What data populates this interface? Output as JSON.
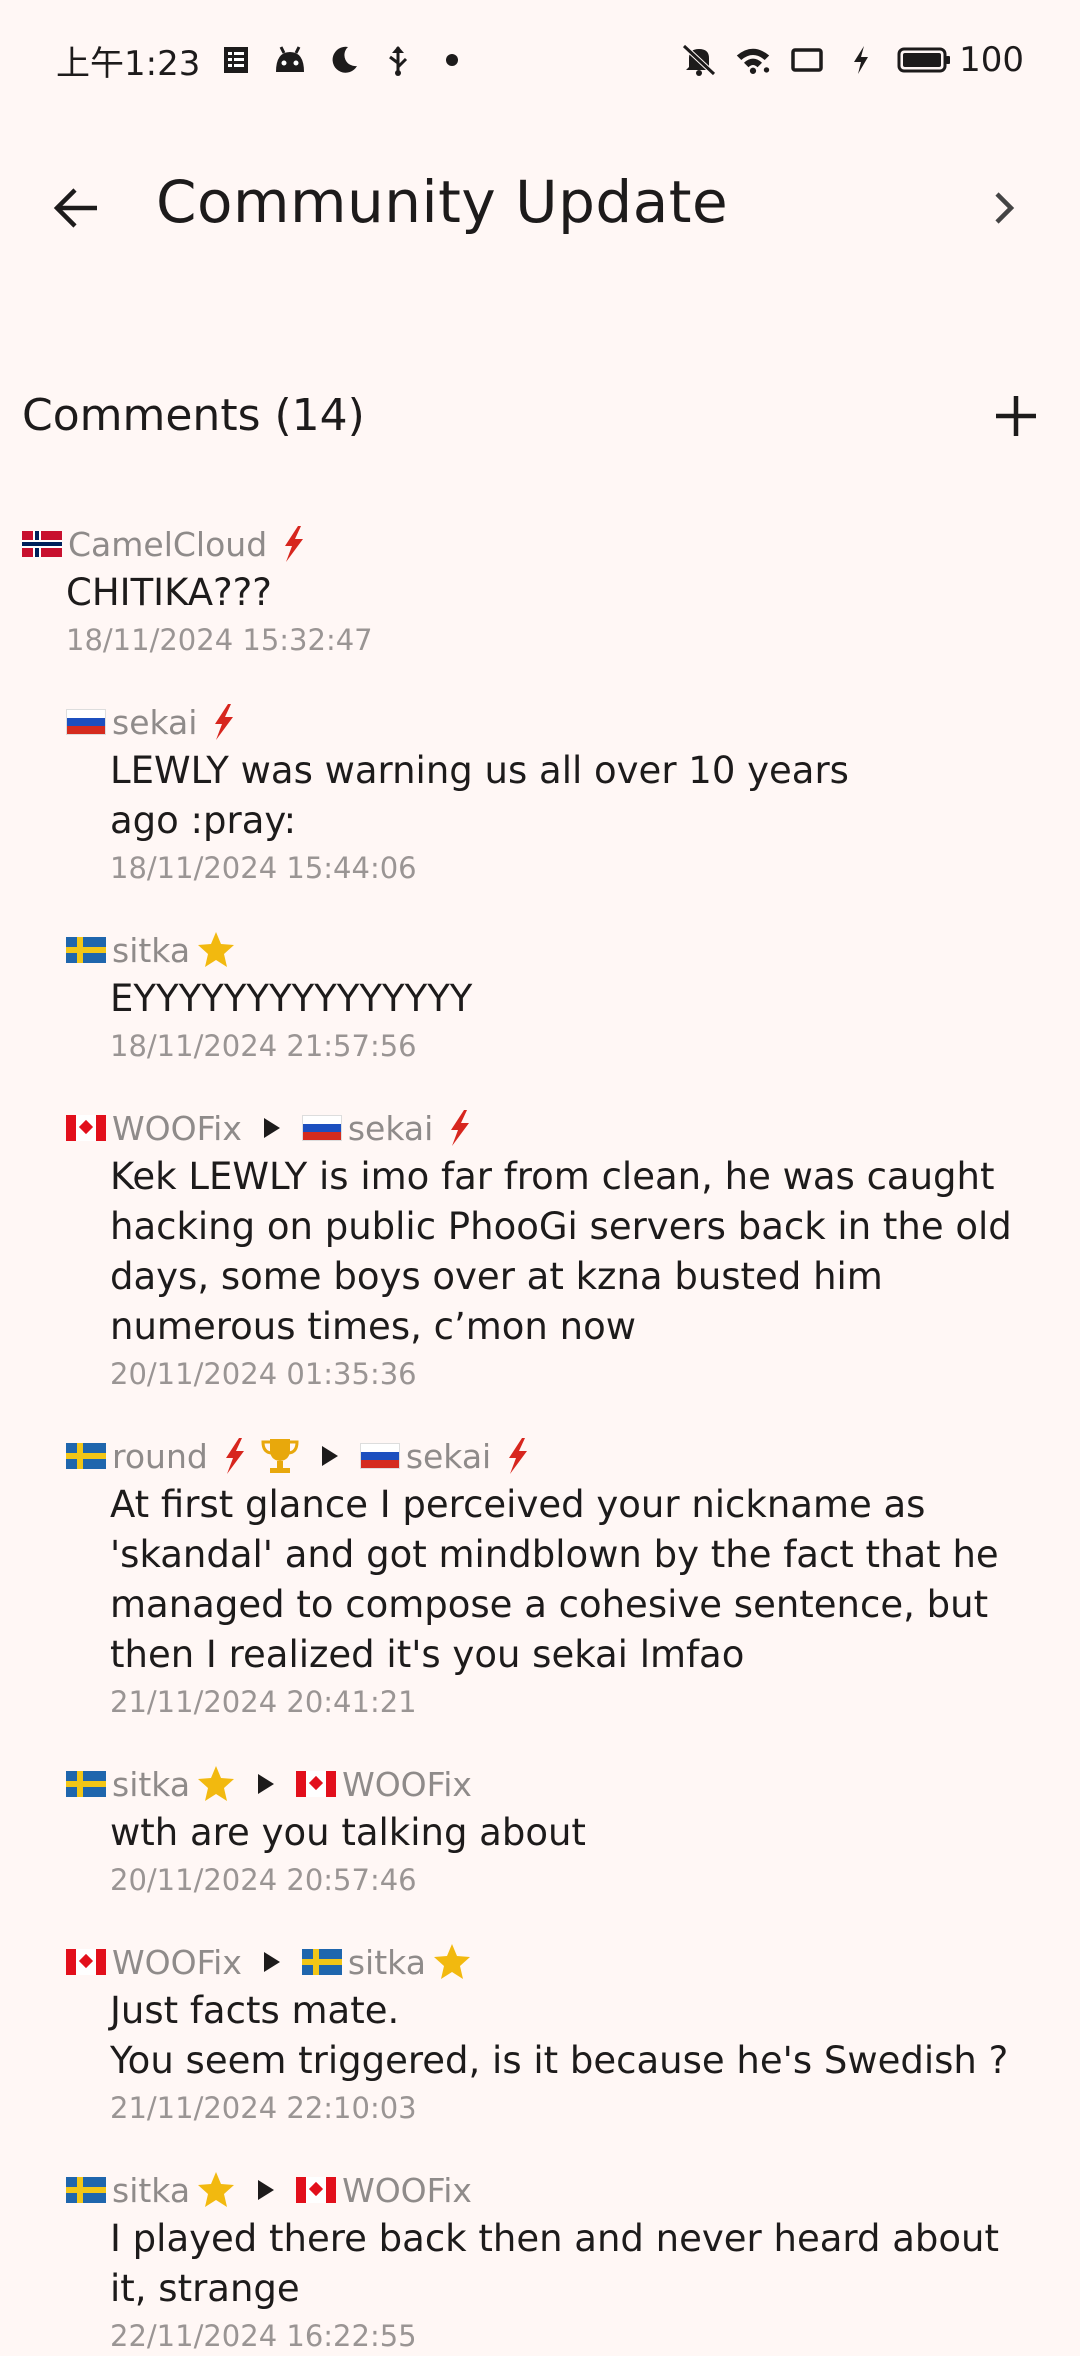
{
  "status_bar": {
    "time": "上午1:23",
    "battery": "100",
    "icons": [
      "document-icon",
      "android-icon",
      "moon-icon",
      "usb-icon",
      "dot-icon",
      "mute-icon",
      "wifi-icon",
      "screen-icon",
      "charging-icon",
      "battery-icon"
    ]
  },
  "app_bar": {
    "title": "Community Update",
    "back_icon": "arrow-left-icon",
    "next_icon": "chevron-right-icon"
  },
  "comments_section": {
    "title": "Comments (14)",
    "add_icon": "plus-icon"
  },
  "comments": [
    {
      "author": "CamelCloud",
      "flag": "no",
      "badges": [
        "lightning"
      ],
      "text": "CHITIKA???",
      "time": "18/11/2024 15:32:47"
    },
    {
      "author": "sekai",
      "flag": "ru",
      "badges": [
        "lightning"
      ],
      "text": "LEWLY was warning us all over 10 years ago :pray:",
      "time": "18/11/2024 15:44:06"
    },
    {
      "author": "sitka",
      "flag": "se",
      "badges": [
        "star"
      ],
      "text": "EYYYYYYYYYYYYYYY",
      "time": "18/11/2024 21:57:56"
    },
    {
      "author": "WOOFix",
      "flag": "ca",
      "badges": [],
      "reply_to": "sekai",
      "reply_flag": "ru",
      "reply_badges": [
        "lightning"
      ],
      "text": "Kek LEWLY is imo far from clean, he was caught hacking on public PhooGi servers back in the old days, some boys over at kzna busted him numerous times, c’mon now",
      "time": "20/11/2024 01:35:36"
    },
    {
      "author": "round",
      "flag": "se",
      "badges": [
        "lightning",
        "trophy"
      ],
      "reply_to": "sekai",
      "reply_flag": "ru",
      "reply_badges": [
        "lightning"
      ],
      "text": "At first glance I perceived your nickname as 'skandal' and got mindblown by the fact that he managed to compose a cohesive sentence, but then I realized it's you sekai lmfao",
      "time": "21/11/2024 20:41:21"
    },
    {
      "author": "sitka",
      "flag": "se",
      "badges": [
        "star"
      ],
      "reply_to": "WOOFix",
      "reply_flag": "ca",
      "reply_badges": [],
      "text": "wth are you talking about",
      "time": "20/11/2024 20:57:46"
    },
    {
      "author": "WOOFix",
      "flag": "ca",
      "badges": [],
      "reply_to": "sitka",
      "reply_flag": "se",
      "reply_badges": [
        "star"
      ],
      "text_line1": "Just facts mate.",
      "text_line2": "You seem triggered, is it because he's Swedish ?",
      "time": "21/11/2024 22:10:03"
    },
    {
      "author": "sitka",
      "flag": "se",
      "badges": [
        "star"
      ],
      "reply_to": "WOOFix",
      "reply_flag": "ca",
      "reply_badges": [],
      "text": "I played there back then and never heard about it, strange",
      "time": "22/11/2024 16:22:55"
    }
  ],
  "colors": {
    "background": "#fff7f5",
    "text": "#1d1b1b",
    "meta": "#8f8b8a",
    "lightning": "#d7261e",
    "star": "#f2b90f",
    "trophy": "#e8a80c"
  }
}
